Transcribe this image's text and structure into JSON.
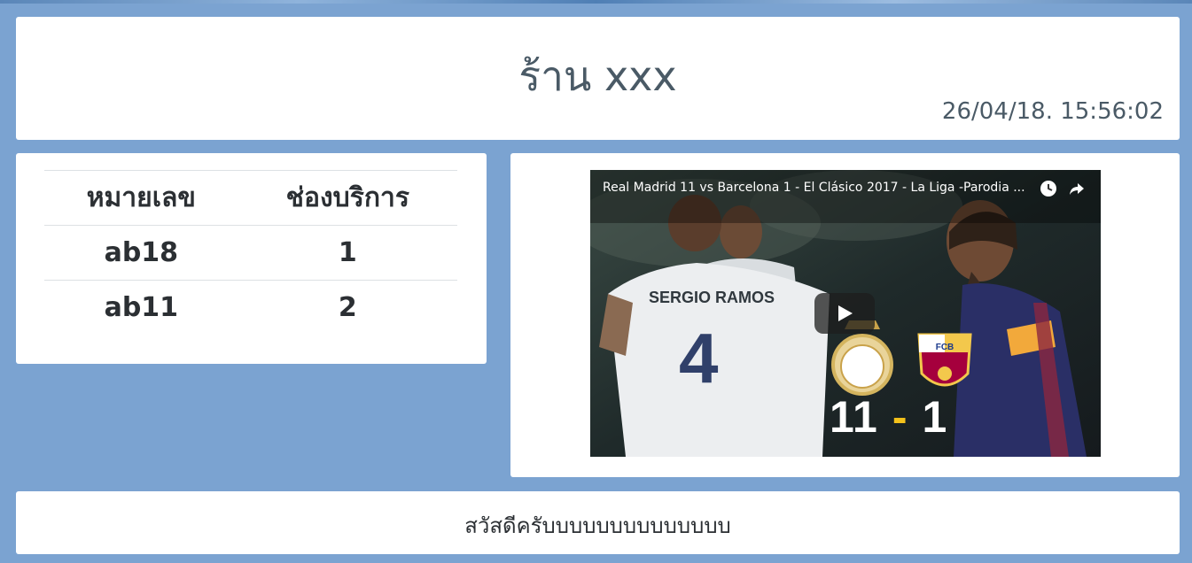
{
  "header": {
    "shop_name": "ร้าน xxx",
    "datetime": "26/04/18. 15:56:02"
  },
  "queue_table": {
    "columns": [
      "หมายเลข",
      "ช่องบริการ"
    ],
    "rows": [
      {
        "number": "ab18",
        "counter": "1"
      },
      {
        "number": "ab11",
        "counter": "2"
      }
    ]
  },
  "video": {
    "title": "Real Madrid 11 vs Barcelona 1 - El Clásico 2017 - La Liga -Parodia ...",
    "score_left": "11",
    "score_separator": "-",
    "score_right": "1",
    "jersey_name": "SERGIO RAMOS",
    "jersey_number": "4",
    "badge_text": "FCB",
    "icons": [
      "watch-later-icon",
      "share-icon",
      "play-icon"
    ]
  },
  "footer": {
    "message": "สวัสดีครับบบบบบบบบบบบบบ"
  },
  "colors": {
    "background": "#7ba3d1",
    "card": "#ffffff",
    "text": "#4a5a66",
    "score_dash": "#f4c21b"
  }
}
